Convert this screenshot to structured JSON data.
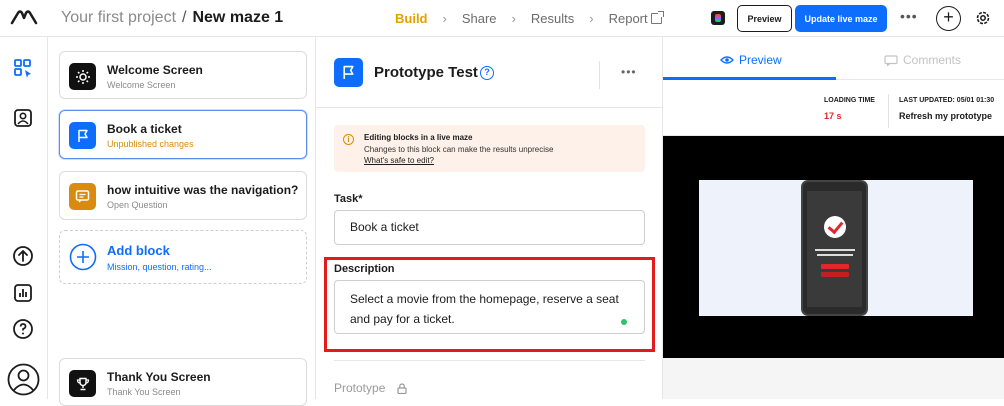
{
  "header": {
    "project": "Your first project",
    "separator": "/",
    "maze": "New maze 1",
    "steps": [
      "Build",
      "Share",
      "Results",
      "Report"
    ],
    "preview_label": "Preview",
    "update_label": "Update live maze",
    "more": "•••",
    "plus": "+"
  },
  "blocks": [
    {
      "title": "Welcome Screen",
      "sub": "Welcome Screen"
    },
    {
      "title": "Book a ticket",
      "sub": "Unpublished changes"
    },
    {
      "title": "how intuitive was the navigation?",
      "sub": "Open Question"
    }
  ],
  "add_block": {
    "title": "Add block",
    "sub": "Mission, question, rating..."
  },
  "thank_you": {
    "title": "Thank You Screen",
    "sub": "Thank You Screen"
  },
  "editor": {
    "title": "Prototype Test",
    "help": "?",
    "more": "•••",
    "notice_title": "Editing blocks in a live maze",
    "notice_desc": "Changes to this block can make the results unprecise",
    "notice_link": "What's safe to edit?",
    "task_label": "Task*",
    "task_value": "Book a ticket",
    "desc_label": "Description",
    "desc_value": "Select a movie from the homepage, reserve a seat and pay for a ticket.",
    "prototype_label": "Prototype"
  },
  "preview": {
    "tab_preview": "Preview",
    "tab_comments": "Comments",
    "loading_label": "LOADING TIME",
    "loading_value": "17 s",
    "updated_label": "LAST UPDATED: 05/01 01:30",
    "refresh_label": "Refresh my prototype"
  },
  "colors": {
    "accent": "#0d6efd",
    "build": "#e8a000",
    "warn": "#d98b10",
    "loading_value": "#e4262b",
    "highlight_box": "#e41b1b"
  }
}
